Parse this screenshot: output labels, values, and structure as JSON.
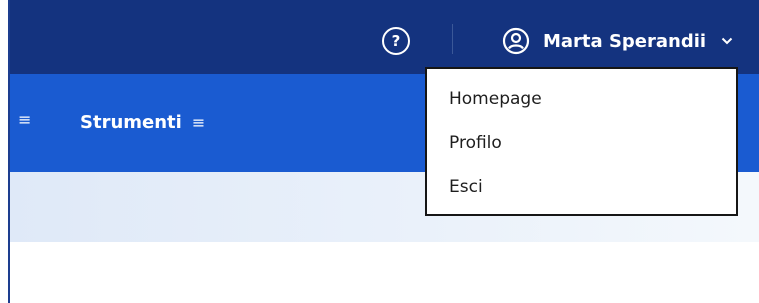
{
  "header": {
    "help_symbol": "?",
    "user_name": "Marta Sperandii",
    "colors": {
      "topbar": "#14337f",
      "text": "#ffffff"
    }
  },
  "nav": {
    "items": [
      {
        "label": ""
      },
      {
        "label": "Strumenti"
      }
    ],
    "menu_symbol": "≡",
    "colors": {
      "navbar": "#1a5bd1"
    }
  },
  "user_menu": {
    "items": [
      {
        "label": "Homepage"
      },
      {
        "label": "Profilo"
      },
      {
        "label": "Esci"
      }
    ]
  },
  "icons": [
    "help-icon",
    "user-circle-icon",
    "chevron-down-icon",
    "hamburger-icon"
  ]
}
